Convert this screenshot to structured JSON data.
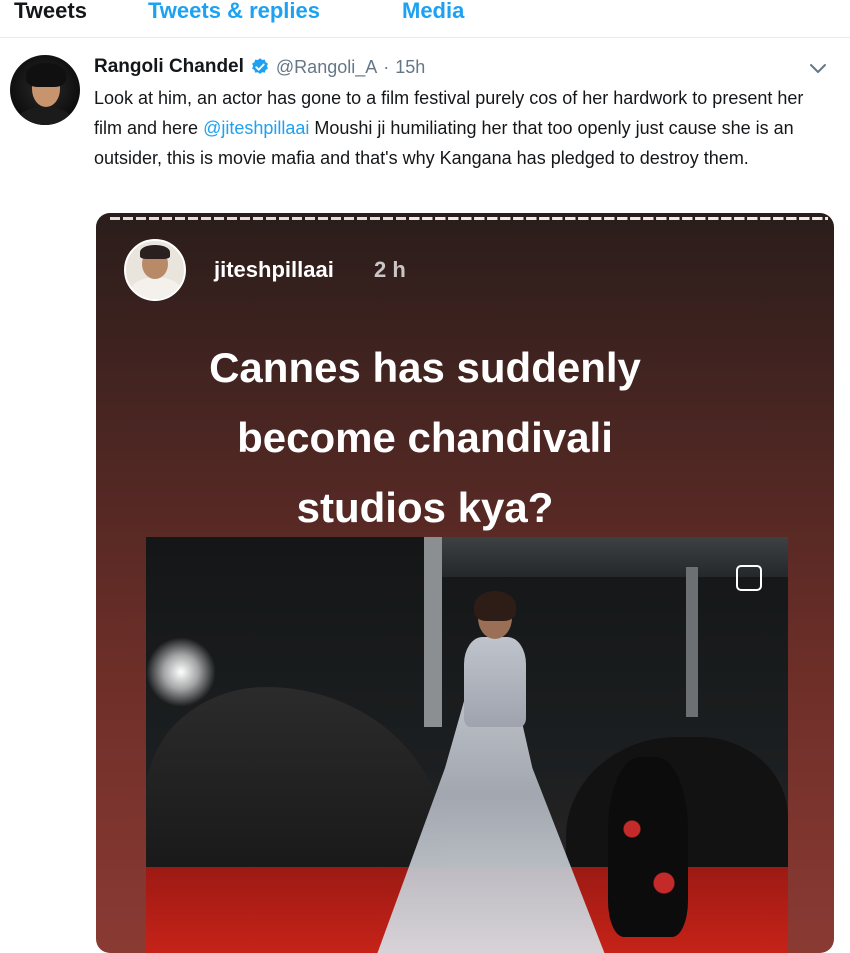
{
  "tabs": [
    {
      "label": "Tweets",
      "active": true
    },
    {
      "label": "Tweets & replies",
      "active": false
    },
    {
      "label": "Media",
      "active": false
    }
  ],
  "tweet": {
    "author_name": "Rangoli Chandel",
    "handle": "@Rangoli_A",
    "separator": "·",
    "time": "15h",
    "text_before": "Look at him, an actor has gone to a film festival purely cos of her hardwork to present her film and here ",
    "mention": "@jiteshpillaai",
    "text_after": " Moushi ji humiliating her that too openly just cause she is an outsider, this is movie mafia and that's why Kangana has pledged to destroy them.",
    "icons": [
      "verified-icon",
      "chevron-down-icon"
    ]
  },
  "story": {
    "username": "jiteshpillaai",
    "time": "2 h",
    "headline_lines": [
      "Cannes has suddenly",
      "become chandivali",
      "studios kya?"
    ]
  },
  "colors": {
    "link": "#1da1f2",
    "text": "#14171a",
    "muted": "#657786",
    "story_bg_top": "#2a1d1b",
    "story_bg_bottom": "#8a3a33",
    "carpet": "#c82318"
  }
}
